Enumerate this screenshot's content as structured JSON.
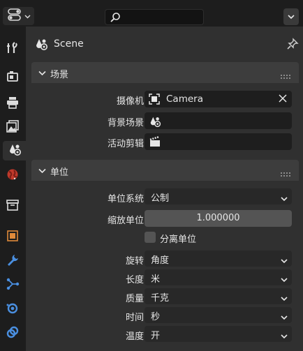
{
  "toolbar": {
    "editor_type_icon": "editor-type-icon",
    "search_value": "",
    "dropdown_icon": "chevron-down-icon"
  },
  "sidebar": {
    "tabs": [
      {
        "name": "tool",
        "icon": "tool-icon"
      },
      {
        "name": "render",
        "icon": "render-icon"
      },
      {
        "name": "output",
        "icon": "printer-icon"
      },
      {
        "name": "view-layer",
        "icon": "image-icon"
      },
      {
        "name": "scene",
        "icon": "scene-icon",
        "active": true
      },
      {
        "name": "world",
        "icon": "world-icon"
      },
      {
        "name": "collection",
        "icon": "collection-box-icon"
      },
      {
        "name": "object",
        "icon": "object-icon"
      },
      {
        "name": "modifiers",
        "icon": "wrench-icon"
      },
      {
        "name": "particles",
        "icon": "particles-icon"
      },
      {
        "name": "physics",
        "icon": "physics-icon"
      },
      {
        "name": "constraints",
        "icon": "constraint-icon"
      }
    ]
  },
  "header": {
    "title": "Scene"
  },
  "scene_panel": {
    "title": "场景",
    "camera_label": "摄像机",
    "camera_value": "Camera",
    "background_label": "背景场景",
    "background_value": "",
    "clip_label": "活动剪辑",
    "clip_value": ""
  },
  "units_panel": {
    "title": "单位",
    "system_label": "单位系统",
    "system_value": "公制",
    "scale_label": "缩放单位",
    "scale_value": "1.000000",
    "separate_label": "分离单位",
    "separate_checked": false,
    "rotation_label": "旋转",
    "rotation_value": "角度",
    "length_label": "长度",
    "length_value": "米",
    "mass_label": "质量",
    "mass_value": "千克",
    "time_label": "时间",
    "time_value": "秒",
    "temperature_label": "温度",
    "temperature_value": "开"
  },
  "colors": {
    "background": "#303030",
    "panel_header": "#3d3d3d",
    "field": "#1e1e1e",
    "accent_object": "#e08a3a",
    "accent_wrench": "#4a8fe0"
  }
}
